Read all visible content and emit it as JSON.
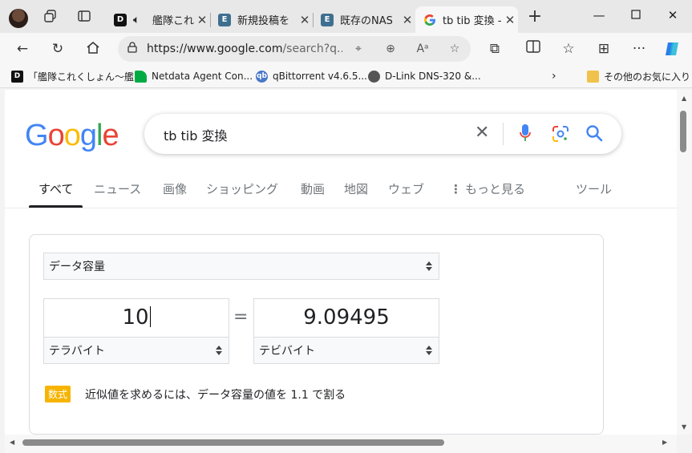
{
  "tabs": [
    {
      "title": "艦隊これ",
      "favicon": "D",
      "fav_color": "#111111",
      "has_sound": true
    },
    {
      "title": "新規投稿を",
      "favicon": "E",
      "fav_color": "#3f6f8f"
    },
    {
      "title": "既存のNAS",
      "favicon": "E",
      "fav_color": "#3f6f8f"
    },
    {
      "title": "tb tib 変換 -",
      "favicon": "G",
      "fav_color": "#ffffff",
      "active": true
    }
  ],
  "address": {
    "url_host": "https://www.google.com",
    "url_rest": "/search?q..."
  },
  "bookmarks": [
    {
      "label": "「艦隊これくしょん〜艦...",
      "favicon": "D"
    },
    {
      "label": "Netdata Agent Con...",
      "favicon": "N"
    },
    {
      "label": "qBittorrent v4.6.5...",
      "favicon": "qb"
    },
    {
      "label": "D-Link DNS-320 &...",
      "favicon": "dl"
    },
    {
      "label": "その他のお気に入り",
      "favicon": "folder"
    }
  ],
  "search": {
    "query": "tb tib 変換"
  },
  "nav_tabs": [
    {
      "label": "すべて",
      "active": true
    },
    {
      "label": "ニュース"
    },
    {
      "label": "画像"
    },
    {
      "label": "ショッピング"
    },
    {
      "label": "動画"
    },
    {
      "label": "地図"
    },
    {
      "label": "ウェブ"
    },
    {
      "label": "もっと見る"
    },
    {
      "label": "ツール"
    }
  ],
  "converter": {
    "category": "データ容量",
    "from_value": "10",
    "from_unit": "テラバイト",
    "to_value": "9.09495",
    "to_unit": "テビバイト",
    "equals": "=",
    "formula_badge": "数式",
    "formula_text": "近似値を求めるには、データ容量の値を 1.1 で割る"
  },
  "colors": {
    "google_blue": "#4285f4",
    "google_red": "#ea4335",
    "google_yellow": "#fbbc05",
    "google_green": "#34a853",
    "formula_badge": "#f6b400"
  }
}
